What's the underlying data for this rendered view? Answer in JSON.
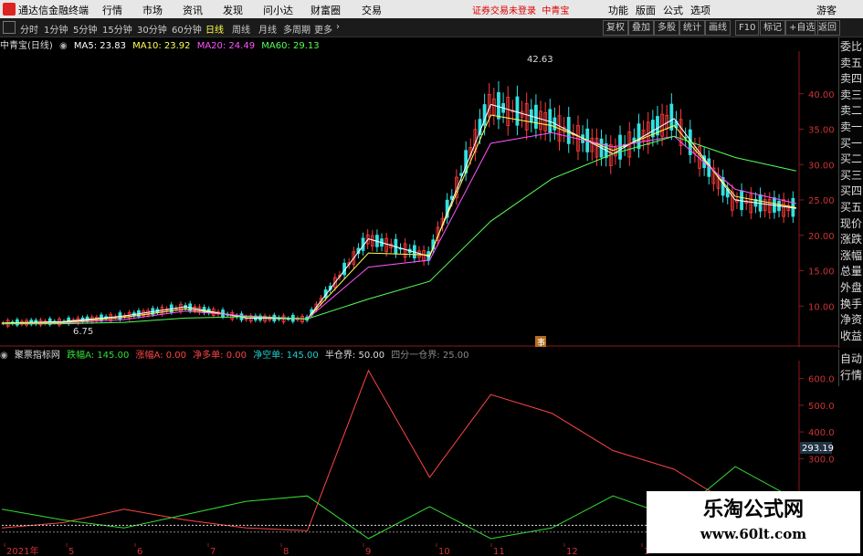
{
  "app": {
    "title": "通达信金融终端",
    "menu": [
      "行情",
      "市场",
      "资讯",
      "发现",
      "问小达",
      "财富圈",
      "交易"
    ],
    "notice": "证券交易未登录",
    "stock_name": "中青宝",
    "right_menu": [
      "功能",
      "版面",
      "公式",
      "选项"
    ],
    "user": "游客"
  },
  "toolbar": {
    "periods": [
      "分时",
      "1分钟",
      "5分钟",
      "15分钟",
      "30分钟",
      "60分钟",
      "日线",
      "周线",
      "月线",
      "多周期",
      "更多"
    ],
    "active_period": "日线",
    "right_buttons": [
      "复权",
      "叠加",
      "多股",
      "统计",
      "画线",
      "F10",
      "标记",
      "+自选",
      "返回"
    ]
  },
  "main_legend": {
    "title": "中青宝(日线)",
    "ma": [
      {
        "label": "MA5: 23.83",
        "color": "#ffffff"
      },
      {
        "label": "MA10: 23.92",
        "color": "#ffff55"
      },
      {
        "label": "MA20: 24.49",
        "color": "#ff55ff"
      },
      {
        "label": "MA60: 29.13",
        "color": "#55ff55"
      }
    ]
  },
  "indicator_legend": {
    "name": "聚票指标网",
    "items": [
      {
        "label": "跌幅A: 145.00",
        "color": "#33dd33"
      },
      {
        "label": "涨幅A: 0.00",
        "color": "#ff4444"
      },
      {
        "label": "净多单: 0.00",
        "color": "#ff4444"
      },
      {
        "label": "净空单: 145.00",
        "color": "#22cccc"
      },
      {
        "label": "半仓界: 50.00",
        "color": "#dddddd"
      },
      {
        "label": "四分一仓界: 25.00",
        "color": "#888888"
      }
    ]
  },
  "side_panel": [
    "委比",
    "卖五",
    "卖四",
    "卖三",
    "卖二",
    "卖一",
    "买一",
    "买二",
    "买三",
    "买四",
    "买五",
    "现价",
    "涨跌",
    "涨幅",
    "总量",
    "外盘",
    "换手",
    "净资",
    "收益"
  ],
  "side_bottom": [
    "自动",
    "行情"
  ],
  "price_axis": [
    "40.00",
    "35.00",
    "30.00",
    "25.00",
    "20.00",
    "15.00",
    "10.00"
  ],
  "indicator_axis": [
    "600.0",
    "500.0",
    "400.0",
    "300.0"
  ],
  "indicator_current": "293.19",
  "annotations": {
    "high": "42.63",
    "low": "6.75",
    "event": "事"
  },
  "x_axis": [
    "2021年",
    "5",
    "6",
    "7",
    "8",
    "9",
    "10",
    "11",
    "12",
    "1"
  ],
  "watermark": {
    "line1": "乐淘公式网",
    "line2": "www.60lt.com"
  },
  "chart_data": {
    "type": "line",
    "title": "中青宝(日线)",
    "ylim": [
      5,
      45
    ],
    "x": [
      "2021年",
      "5",
      "6",
      "7",
      "8",
      "9",
      "10",
      "11",
      "12",
      "1"
    ],
    "series": [
      {
        "name": "MA5",
        "values": [
          7.6,
          7.8,
          8.6,
          9.9,
          8.3,
          8.2,
          19.5,
          17.0,
          38.5,
          36.0,
          31.5,
          36.5,
          25.0,
          23.8
        ]
      },
      {
        "name": "MA10",
        "values": [
          7.6,
          7.7,
          8.4,
          9.6,
          8.5,
          8.2,
          17.5,
          17.2,
          37.0,
          35.5,
          32.0,
          35.5,
          25.5,
          23.9
        ]
      },
      {
        "name": "MA20",
        "values": [
          7.5,
          7.6,
          8.1,
          9.3,
          8.6,
          8.2,
          15.5,
          16.5,
          33.0,
          34.5,
          32.5,
          34.0,
          26.5,
          24.5
        ]
      },
      {
        "name": "MA60",
        "values": [
          7.5,
          7.5,
          7.7,
          8.3,
          8.5,
          8.2,
          11.0,
          13.5,
          22.0,
          28.0,
          31.5,
          34.0,
          31.0,
          29.1
        ]
      }
    ],
    "indicator": {
      "ylim": [
        0,
        650
      ],
      "series": [
        {
          "name": "涨幅A",
          "values": [
            40,
            60,
            110,
            70,
            40,
            30,
            630,
            230,
            540,
            470,
            330,
            260,
            120,
            0
          ]
        },
        {
          "name": "跌幅A",
          "values": [
            110,
            70,
            40,
            90,
            140,
            160,
            0,
            120,
            0,
            40,
            160,
            80,
            270,
            145
          ]
        },
        {
          "name": "半仓界",
          "values": [
            50,
            50,
            50,
            50,
            50,
            50,
            50,
            50,
            50,
            50,
            50,
            50,
            50,
            50
          ]
        },
        {
          "name": "四分一仓界",
          "values": [
            25,
            25,
            25,
            25,
            25,
            25,
            25,
            25,
            25,
            25,
            25,
            25,
            25,
            25
          ]
        }
      ]
    }
  }
}
